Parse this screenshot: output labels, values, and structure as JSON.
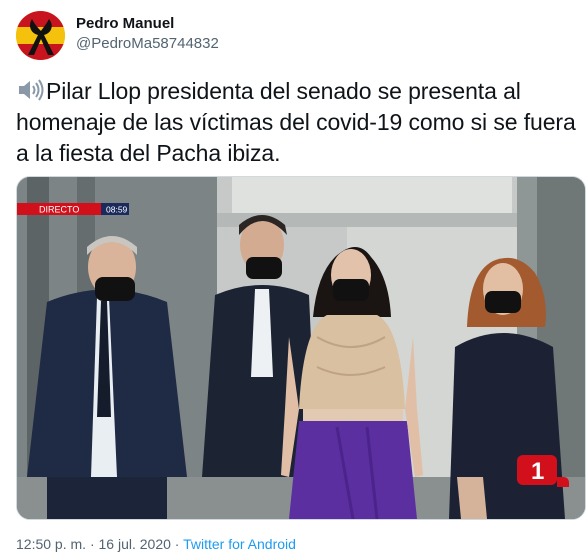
{
  "author": {
    "display_name": "Pedro Manuel",
    "handle": "@PedroMa58744832"
  },
  "tweet": {
    "text": "Pilar Llop presidenta del senado se presenta al homenaje de las víctimas del covid-19 como si se fuera a la fiesta del Pacha ibiza.",
    "speaker_icon": "speaker-icon"
  },
  "media": {
    "live_label": "DIRECTO",
    "clock": "08:59",
    "channel_logo": "1"
  },
  "meta": {
    "time": "12:50 p. m.",
    "separator1": "·",
    "date": "16 jul. 2020",
    "separator2": "·",
    "source": "Twitter for Android"
  },
  "colors": {
    "link": "#1d9bf0",
    "secondary_text": "#536471",
    "live_red": "#d1101b"
  }
}
